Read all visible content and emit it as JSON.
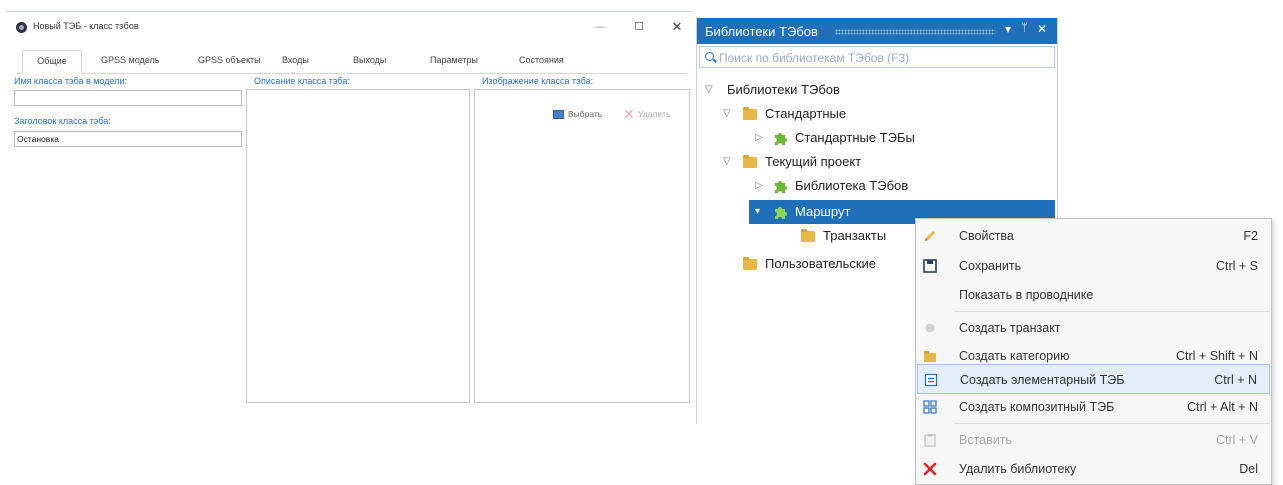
{
  "window": {
    "title": "Новый ТЭБ - класс тэбов",
    "controls": {
      "minimize": "—",
      "maximize": "☐",
      "close": "✕"
    }
  },
  "tabs": [
    "Общие",
    "GPSS модель",
    "GPSS объекты",
    "Входы",
    "Выходы",
    "Параметры",
    "Состояния"
  ],
  "form": {
    "class_name_label": "Имя класса тэба в модели:",
    "class_name_value": "",
    "header_label": "Заголовок класса тэба:",
    "header_value": "Остановка",
    "description_label": "Описание класса тэба:",
    "image_label": "Изображение класса тэба:",
    "select_button": "Выбрать",
    "delete_button": "Удалить"
  },
  "library": {
    "title": "Библиотеки ТЭбов",
    "header_buttons": {
      "dropdown": "▾",
      "pin": "ᛘ",
      "close": "✕"
    },
    "search_placeholder": "Поиск по библиотекам ТЭбов (F3)",
    "tree": {
      "root": "Библиотеки ТЭбов",
      "standard": "Стандартные",
      "standard_tebs": "Стандартные ТЭБы",
      "current_project": "Текущий проект",
      "teb_library": "Библиотека ТЭбов",
      "route": "Маршрут",
      "transacts": "Транзакты",
      "user": "Пользовательские"
    }
  },
  "context_menu": [
    {
      "label": "Свойства",
      "shortcut": "F2",
      "icon": "pencil-icon",
      "disabled": false
    },
    {
      "label": "Сохранить",
      "shortcut": "Ctrl + S",
      "icon": "save-icon",
      "disabled": false
    },
    {
      "label": "Показать в проводнике",
      "shortcut": "",
      "icon": "",
      "disabled": false
    },
    {
      "label": "Создать транзакт",
      "shortcut": "",
      "icon": "transact-icon",
      "disabled": false
    },
    {
      "label": "Создать категорию",
      "shortcut": "Ctrl + Shift + N",
      "icon": "folder-icon",
      "disabled": false
    },
    {
      "label": "Создать элементарный ТЭБ",
      "shortcut": "Ctrl + N",
      "icon": "elementary-teb-icon",
      "disabled": false,
      "highlighted": true
    },
    {
      "label": "Создать композитный ТЭБ",
      "shortcut": "Ctrl + Alt + N",
      "icon": "composite-teb-icon",
      "disabled": false
    },
    {
      "label": "Вставить",
      "shortcut": "Ctrl + V",
      "icon": "paste-icon",
      "disabled": true
    },
    {
      "label": "Удалить библиотеку",
      "shortcut": "Del",
      "icon": "delete-icon",
      "disabled": false
    }
  ],
  "colors": {
    "accent": "#1f70b8",
    "label_blue": "#2a70c0",
    "folder": "#e6b84a",
    "teb_green": "#6fb83a",
    "delete_red": "#d9262a"
  }
}
